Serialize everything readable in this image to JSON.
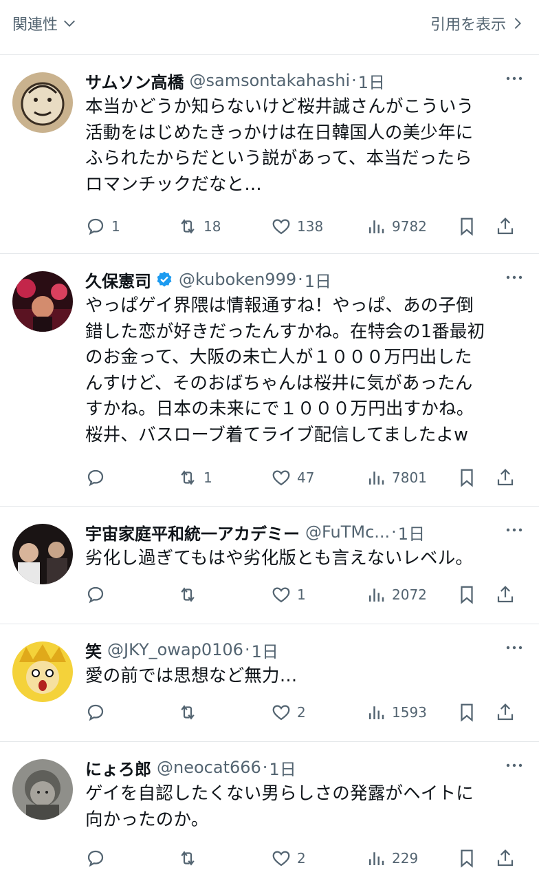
{
  "header": {
    "sort_label": "関連性",
    "quotes_label": "引用を表示"
  },
  "colors": {
    "text": "#0f1419",
    "muted": "#536471",
    "verified": "#1d9bf0",
    "divider": "#e4e7ea"
  },
  "tweets": [
    {
      "name": "サムソン高橋",
      "handle": "@samsontakahashi",
      "time": "1日",
      "verified": false,
      "text": "本当かどうか知らないけど桜井誠さんがこういう\n活動をはじめたきっかけは在日韓国人の美少年に\nふられたからだという説があって、本当だったら\nロマンチックだなと…",
      "replies": "1",
      "retweets": "18",
      "likes": "138",
      "views": "9782"
    },
    {
      "name": "久保憲司",
      "handle": "@kuboken999",
      "time": "1日",
      "verified": true,
      "text": "やっぱゲイ界隈は情報通すね！やっぱ、あの子倒\n錯した恋が好きだったんすかね。在特会の1番最初\nのお金って、大阪の未亡人が１０００万円出した\nんすけど、そのおばちゃんは桜井に気があったん\nすかね。日本の未来にで１０００万円出すかね。\n桜井、バスローブ着てライブ配信してましたよw",
      "replies": "",
      "retweets": "1",
      "likes": "47",
      "views": "7801"
    },
    {
      "name": "宇宙家庭平和統一アカデミー",
      "handle": "@FuTMc...",
      "time": "1日",
      "verified": false,
      "text": "劣化し過ぎてもはや劣化版とも言えないレベル。",
      "replies": "",
      "retweets": "",
      "likes": "1",
      "views": "2072"
    },
    {
      "name": "笑",
      "handle": "@JKY_owap0106",
      "time": "1日",
      "verified": false,
      "text": "愛の前では思想など無力…",
      "replies": "",
      "retweets": "",
      "likes": "2",
      "views": "1593"
    },
    {
      "name": "にょろ郎",
      "handle": "@neocat666",
      "time": "1日",
      "verified": false,
      "text": "ゲイを自認したくない男らしさの発露がヘイトに\n向かったのか。",
      "replies": "",
      "retweets": "",
      "likes": "2",
      "views": "229"
    }
  ]
}
